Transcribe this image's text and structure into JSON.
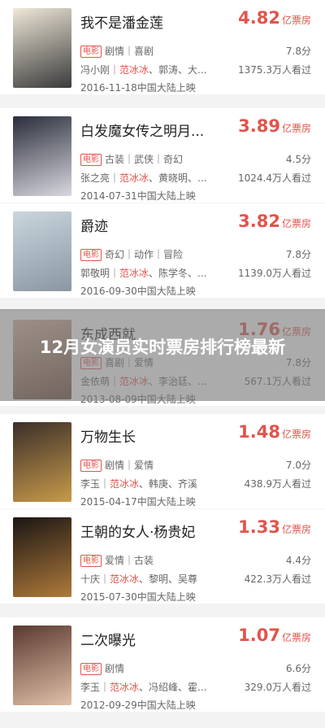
{
  "overlay": {
    "title": "12月女演员实时票房排行榜最新"
  },
  "movies": [
    {
      "title": "我不是潘金莲",
      "box": "4.82",
      "unit": "亿票房",
      "tag": "电影",
      "genres": "剧情｜喜剧",
      "rating": "7.8分",
      "cast_before": "冯小刚｜",
      "cast_hl": "范冰冰",
      "cast_after": "、郭涛、大...",
      "viewers": "1375.3万人看过",
      "release": "2016-11-18中国大陆上映",
      "poster_colors": [
        "#efe8d8",
        "#3a3a3a"
      ]
    },
    {
      "title": "白发魔女传之明月...",
      "box": "3.89",
      "unit": "亿票房",
      "tag": "电影",
      "genres": "古装｜武侠｜奇幻",
      "rating": "4.5分",
      "cast_before": "张之亮｜",
      "cast_hl": "范冰冰",
      "cast_after": "、黄晓明、...",
      "viewers": "1024.4万人看过",
      "release": "2014-07-31中国大陆上映",
      "poster_colors": [
        "#2a2d3a",
        "#d8d8e0"
      ]
    },
    {
      "title": "爵迹",
      "box": "3.82",
      "unit": "亿票房",
      "tag": "电影",
      "genres": "奇幻｜动作｜冒险",
      "rating": "7.8分",
      "cast_before": "郭敬明｜",
      "cast_hl": "范冰冰",
      "cast_after": "、陈学冬、...",
      "viewers": "1139.0万人看过",
      "release": "2016-09-30中国大陆上映",
      "poster_colors": [
        "#c9d6de",
        "#8a97a2"
      ]
    },
    {
      "title": "东成西就",
      "box": "1.76",
      "unit": "亿票房",
      "tag": "电影",
      "genres": "喜剧｜爱情",
      "rating": "7.8分",
      "cast_before": "金依萌｜",
      "cast_hl": "范冰冰",
      "cast_after": "、李治廷、...",
      "viewers": "567.1万人看过",
      "release": "2013-08-09中国大陆上映",
      "poster_colors": [
        "#d9b7a0",
        "#6b4a3a"
      ]
    },
    {
      "title": "万物生长",
      "box": "1.48",
      "unit": "亿票房",
      "tag": "电影",
      "genres": "剧情｜爱情",
      "rating": "7.0分",
      "cast_before": "李玉｜",
      "cast_hl": "范冰冰",
      "cast_after": "、韩庚、齐溪",
      "viewers": "438.9万人看过",
      "release": "2015-04-17中国大陆上映",
      "poster_colors": [
        "#3a2f2a",
        "#c89a4a"
      ]
    },
    {
      "title": "王朝的女人·杨贵妃",
      "box": "1.33",
      "unit": "亿票房",
      "tag": "电影",
      "genres": "爱情｜古装",
      "rating": "4.4分",
      "cast_before": "十庆｜",
      "cast_hl": "范冰冰",
      "cast_after": "、黎明、吴尊",
      "viewers": "422.3万人看过",
      "release": "2015-07-30中国大陆上映",
      "poster_colors": [
        "#1a1614",
        "#b07a3a"
      ]
    },
    {
      "title": "二次曝光",
      "box": "1.07",
      "unit": "亿票房",
      "tag": "电影",
      "genres": "剧情",
      "rating": "6.6分",
      "cast_before": "李玉｜",
      "cast_hl": "范冰冰",
      "cast_after": "、冯绍峰、霍...",
      "viewers": "329.0万人看过",
      "release": "2012-09-29中国大陆上映",
      "poster_colors": [
        "#5a3a30",
        "#e0c0a8"
      ]
    }
  ]
}
